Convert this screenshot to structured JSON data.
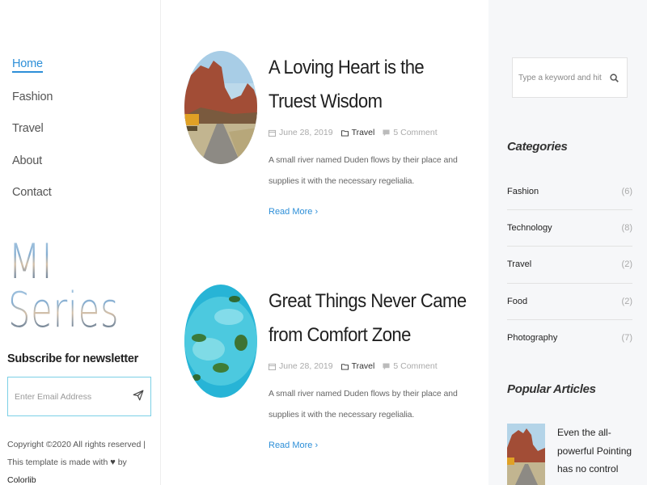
{
  "nav": {
    "items": [
      {
        "label": "Home",
        "active": true
      },
      {
        "label": "Fashion",
        "active": false
      },
      {
        "label": "Travel",
        "active": false
      },
      {
        "label": "About",
        "active": false
      },
      {
        "label": "Contact",
        "active": false
      }
    ]
  },
  "logo": {
    "line1": "MI",
    "line2": "Series"
  },
  "newsletter": {
    "title": "Subscribe for newsletter",
    "placeholder": "Enter Email Address",
    "send_icon": "paper-plane-icon"
  },
  "footer": {
    "copyright": "Copyright ©2020 All rights reserved | This template is made with",
    "heart": "♥",
    "by": "by",
    "brand": "Colorlib"
  },
  "posts": [
    {
      "title": "A Loving Heart is the Truest Wisdom",
      "date": "June 28, 2019",
      "category": "Travel",
      "comments": "5 Comment",
      "excerpt": "A small river named Duden flows by their place and supplies it with the necessary regelialia.",
      "read_more": "Read More",
      "image": "desert-canyon-road"
    },
    {
      "title": "Great Things Never Came from Comfort Zone",
      "date": "June 28, 2019",
      "category": "Travel",
      "comments": "5 Comment",
      "excerpt": "A small river named Duden flows by their place and supplies it with the necessary regelialia.",
      "read_more": "Read More",
      "image": "tropical-islands-aerial"
    }
  ],
  "sidebar": {
    "search_placeholder": "Type a keyword and hit enter",
    "categories_title": "Categories",
    "categories": [
      {
        "name": "Fashion",
        "count": "(6)"
      },
      {
        "name": "Technology",
        "count": "(8)"
      },
      {
        "name": "Travel",
        "count": "(2)"
      },
      {
        "name": "Food",
        "count": "(2)"
      },
      {
        "name": "Photography",
        "count": "(7)"
      }
    ],
    "popular_title": "Popular Articles",
    "popular": [
      {
        "title": "Even the all-powerful Pointing has no control"
      }
    ]
  },
  "colors": {
    "accent": "#2d8fd8",
    "sidebar_bg": "#f6f7f9",
    "input_border": "#7cd0e6"
  }
}
